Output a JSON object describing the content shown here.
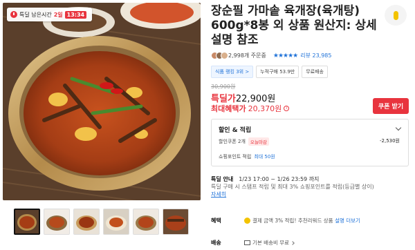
{
  "deal_badge": {
    "prefix": "특딜 남은시간",
    "days": "2일",
    "time": "13:34"
  },
  "product": {
    "title": "장순필 가마솥 육개장(육개탕) 600g*8봉 외 상품 원산지: 상세설명 참조"
  },
  "reviews": {
    "purchases": "2,998개 주문중",
    "stars": "★★★★★",
    "review_count": "리뷰 23,985"
  },
  "tags": [
    "식품 랭킹 3위 >",
    "누적구매 53.9만",
    "무료배송"
  ],
  "price": {
    "original": "30,900원",
    "deal_label": "특딜가",
    "deal_value": "22,900원",
    "max_label": "최대혜택가",
    "max_value": "20,370원"
  },
  "coupon_button": "쿠폰 받기",
  "discount": {
    "heading": "할인 & 적립",
    "coupon_label": "할인쿠폰 2개",
    "coupon_badge": "오늘마감",
    "coupon_amount": "-2,530원",
    "point_label": "쇼핑포인트 적립",
    "point_value": "최대 50원"
  },
  "notice": {
    "title": "특딜 안내",
    "period": "1/23 17:00 ~ 1/26 23:59 까지",
    "desc": "특딜 구매 시 스탬프 적립 및 최대 3% 쇼핑포인트를 적립(등급별 상이)",
    "more": "자세히"
  },
  "benefit": {
    "label": "혜택",
    "text": "결제 금액 3% 적립! 추천리워드 상품",
    "link": "설명 더보기"
  },
  "shipping": {
    "label": "배송",
    "text": "기본 배송비 무료"
  },
  "colors": {
    "accent_red": "#e8343e",
    "link_blue": "#1f72d8"
  }
}
